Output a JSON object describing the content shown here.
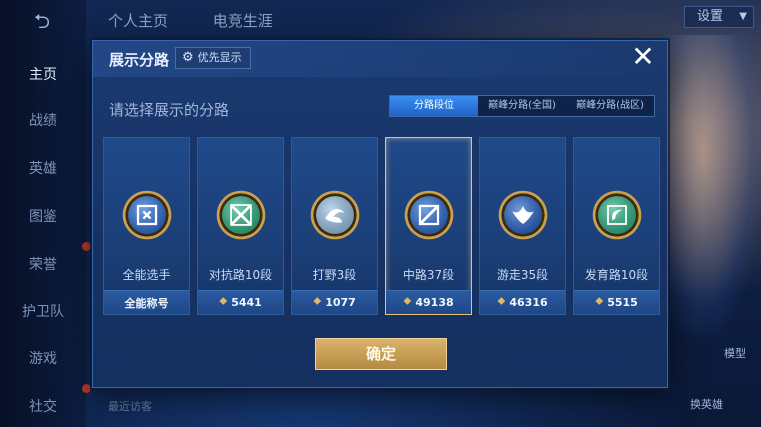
{
  "background": {
    "top_tabs": [
      "个人主页",
      "电竞生涯"
    ],
    "settings_label": "设置",
    "side_nav": [
      "主页",
      "战绩",
      "英雄",
      "图鉴",
      "荣誉",
      "护卫队",
      "游戏",
      "社交"
    ],
    "recent_visitors_label": "最近访客",
    "right_labels": [
      "模型",
      "换英雄"
    ]
  },
  "modal": {
    "title": "展示分路",
    "priority_label": "优先显示",
    "close_icon": "close-icon",
    "subtitle": "请选择展示的分路",
    "tabs": [
      {
        "label": "分路段位",
        "active": true
      },
      {
        "label": "巅峰分路(全国)",
        "active": false
      },
      {
        "label": "巅峰分路(战区)",
        "active": false
      }
    ],
    "cards": [
      {
        "name": "全能选手",
        "footer": "全能称号",
        "has_score": false,
        "selected": false,
        "emblem_color": "#2d6fd6",
        "glyph": "allround"
      },
      {
        "name": "对抗路10段",
        "footer": "5441",
        "has_score": true,
        "selected": false,
        "emblem_color": "#2fb487",
        "glyph": "clash"
      },
      {
        "name": "打野3段",
        "footer": "1077",
        "has_score": true,
        "selected": false,
        "emblem_color": "#9cc4e8",
        "glyph": "jungle"
      },
      {
        "name": "中路37段",
        "footer": "49138",
        "has_score": true,
        "selected": true,
        "emblem_color": "#2d6fd6",
        "glyph": "mid"
      },
      {
        "name": "游走35段",
        "footer": "46316",
        "has_score": true,
        "selected": false,
        "emblem_color": "#2a66cc",
        "glyph": "roam"
      },
      {
        "name": "发育路10段",
        "footer": "5515",
        "has_score": true,
        "selected": false,
        "emblem_color": "#2fb487",
        "glyph": "farm"
      }
    ],
    "confirm_label": "确定"
  },
  "colors": {
    "accent_gold": "#d9b36a",
    "tab_active": "#2f78e0",
    "modal_bg": "#1a3a70"
  }
}
